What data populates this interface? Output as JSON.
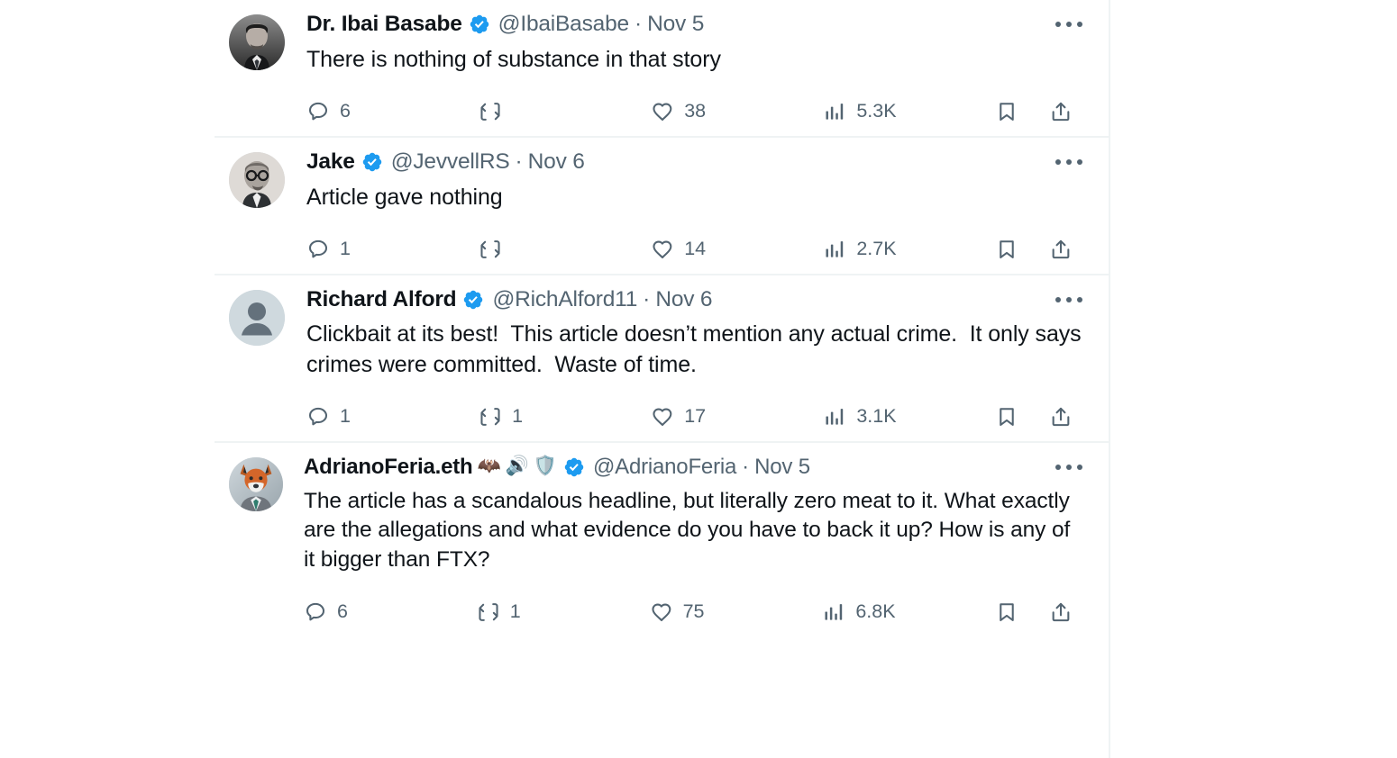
{
  "feed": {
    "tweets": [
      {
        "id": "tweet-ibai-basabe",
        "display_name": "Dr. Ibai Basabe",
        "verified": true,
        "badges": [],
        "handle": "@IbaiBasabe",
        "separator": "·",
        "date": "Nov 5",
        "text": "There is nothing of substance in that story",
        "avatar_kind": "photo-man-suit",
        "more_label": "More",
        "actions": {
          "reply": "6",
          "repost": "",
          "like": "38",
          "views": "5.3K",
          "bookmark": "",
          "share": ""
        }
      },
      {
        "id": "tweet-jake",
        "display_name": "Jake",
        "verified": true,
        "badges": [],
        "handle": "@JevvellRS",
        "separator": "·",
        "date": "Nov 6",
        "text": "Article gave nothing",
        "avatar_kind": "photo-older-man-glasses",
        "more_label": "More",
        "actions": {
          "reply": "1",
          "repost": "",
          "like": "14",
          "views": "2.7K",
          "bookmark": "",
          "share": ""
        }
      },
      {
        "id": "tweet-richard-alford",
        "display_name": "Richard Alford",
        "verified": true,
        "badges": [],
        "handle": "@RichAlford11",
        "separator": "·",
        "date": "Nov 6",
        "text": "Clickbait at its best!  This article doesn’t mention any actual crime.  It only says crimes were committed.  Waste of time.",
        "avatar_kind": "default-placeholder",
        "more_label": "More",
        "actions": {
          "reply": "1",
          "repost": "1",
          "like": "17",
          "views": "3.1K",
          "bookmark": "",
          "share": ""
        }
      },
      {
        "id": "tweet-adrianoferia",
        "display_name": "AdrianoFeria.eth",
        "verified": true,
        "badges": [
          "🦇",
          "🔊",
          "🛡️"
        ],
        "handle": "@AdrianoFeria",
        "separator": "·",
        "date": "Nov 5",
        "text": "The article has a scandalous headline, but literally zero meat to it. What exactly are the allegations and what evidence do you have to back it up? How is any of it bigger than FTX?",
        "avatar_kind": "photo-fox-suit",
        "more_label": "More",
        "actions": {
          "reply": "6",
          "repost": "1",
          "like": "75",
          "views": "6.8K",
          "bookmark": "",
          "share": ""
        }
      }
    ]
  },
  "icons": {
    "reply": "reply-icon",
    "repost": "repost-icon",
    "like": "like-icon",
    "views": "views-icon",
    "bookmark": "bookmark-icon",
    "share": "share-icon",
    "verified": "verified-badge-icon",
    "more": "more-options-icon"
  },
  "colors": {
    "text": "#0f1419",
    "muted": "#536471",
    "verified_blue": "#1d9bf0",
    "separator": "#eff3f4",
    "background": "#ffffff",
    "avatar_placeholder_bg": "#cfd9de",
    "avatar_placeholder_fg": "#64717c"
  }
}
